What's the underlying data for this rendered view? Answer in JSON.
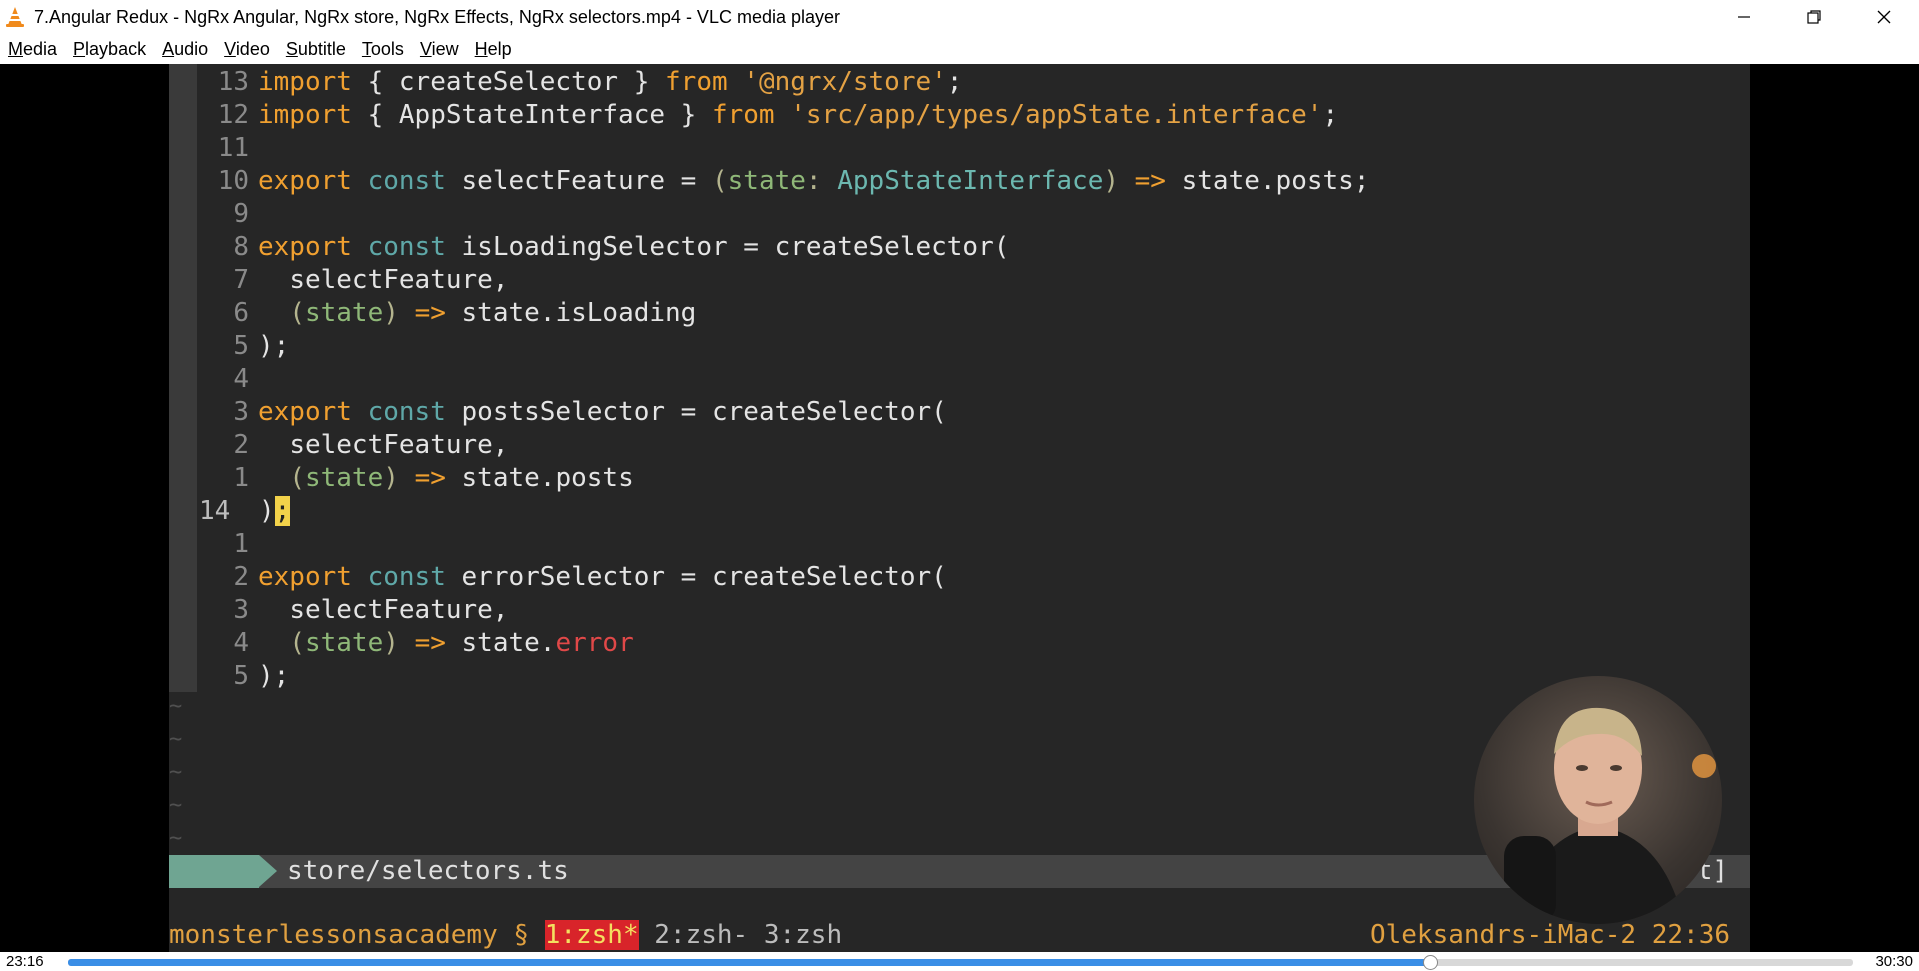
{
  "window": {
    "title": "7.Angular Redux - NgRx Angular, NgRx store, NgRx Effects, NgRx selectors.mp4 - VLC media player"
  },
  "menu": [
    "Media",
    "Playback",
    "Audio",
    "Video",
    "Subtitle",
    "Tools",
    "View",
    "Help"
  ],
  "editor": {
    "lines": {
      "l1": {
        "n": "13"
      },
      "l2": {
        "n": "12"
      },
      "l3": {
        "n": "11"
      },
      "l4": {
        "n": "10"
      },
      "l5": {
        "n": "9"
      },
      "l6": {
        "n": "8"
      },
      "l7": {
        "n": "7"
      },
      "l8": {
        "n": "6"
      },
      "l9": {
        "n": "5"
      },
      "l10": {
        "n": "4"
      },
      "l11": {
        "n": "3"
      },
      "l12": {
        "n": "2"
      },
      "l13": {
        "n": "1"
      },
      "l14": {
        "n": "14"
      },
      "l15": {
        "n": "1"
      },
      "l16": {
        "n": "2"
      },
      "l17": {
        "n": "3"
      },
      "l18": {
        "n": "4"
      },
      "l19": {
        "n": "5"
      }
    },
    "t": {
      "import": "import",
      "from": "from",
      "export": "export",
      "const": "const",
      "arrow": "=>",
      "state": "state",
      "brace_open": "{ ",
      "brace_close": " }",
      "createSelector": "createSelector",
      "ngrx_store": "'@ngrx/store'",
      "AppStateInterface": "AppStateInterface",
      "app_state_path": "'src/app/types/appState.interface'",
      "semicolon": ";",
      "selectFeature": "selectFeature",
      "eq": " = ",
      "l4_open": "(",
      "l4_colon": ": ",
      "l4_close": ")",
      "state_posts_semi": "state.posts;",
      "isLoadingSelector": "isLoadingSelector",
      "createSelector_open": "createSelector(",
      "selectFeature_comma": "selectFeature,",
      "state_isLoading": "state.isLoading",
      "close_paren_semi": ");",
      "postsSelector": "postsSelector",
      "state_posts": "state.posts",
      "close_paren": ")",
      "errorSelector": "errorSelector",
      "state_dot": "state.",
      "error": "error"
    },
    "tildes": [
      "~",
      "~",
      "~",
      "~",
      "~"
    ]
  },
  "statusline": {
    "file": "store/selectors.ts",
    "right": "t]"
  },
  "tmux": {
    "session": "monsterlessonsacademy § ",
    "active_window": "1:zsh*",
    "windows": " 2:zsh- 3:zsh",
    "host_time": "Oleksandrs-iMac-2 22:36"
  },
  "playback": {
    "elapsed": "23:16",
    "total": "30:30",
    "progress": 0.7628
  },
  "colors": {
    "accent": "#3a8ee6",
    "tmux_active": "#d8242a"
  },
  "icons": {
    "app": "vlc-cone-icon",
    "minimize": "minimize-icon",
    "restore": "restore-icon",
    "close": "close-icon"
  }
}
